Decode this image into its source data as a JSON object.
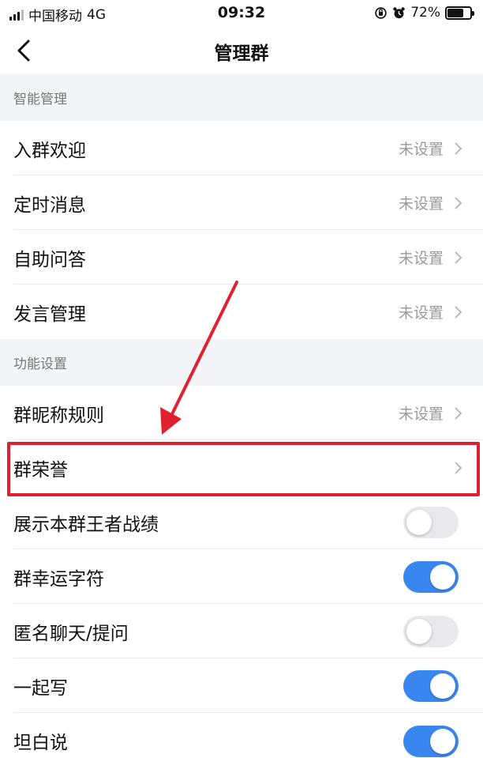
{
  "status_bar": {
    "carrier": "中国移动",
    "network": "4G",
    "time": "09:32",
    "battery": "72%",
    "battery_level": 0.72,
    "icons": [
      "signal-icon",
      "orientation-lock-icon",
      "alarm-icon",
      "battery-icon"
    ]
  },
  "nav": {
    "title": "管理群",
    "back_icon": "chevron-left-icon"
  },
  "sections": [
    {
      "header": "智能管理",
      "items": [
        {
          "label": "入群欢迎",
          "value": "未设置",
          "type": "link"
        },
        {
          "label": "定时消息",
          "value": "未设置",
          "type": "link"
        },
        {
          "label": "自助问答",
          "value": "未设置",
          "type": "link"
        },
        {
          "label": "发言管理",
          "value": "未设置",
          "type": "link"
        }
      ]
    },
    {
      "header": "功能设置",
      "items": [
        {
          "label": "群昵称规则",
          "value": "未设置",
          "type": "link"
        },
        {
          "label": "群荣誉",
          "value": "",
          "type": "link"
        },
        {
          "label": "展示本群王者战绩",
          "type": "toggle",
          "on": false
        },
        {
          "label": "群幸运字符",
          "type": "toggle",
          "on": true
        },
        {
          "label": "匿名聊天/提问",
          "type": "toggle",
          "on": false
        },
        {
          "label": "一起写",
          "type": "toggle",
          "on": true
        },
        {
          "label": "坦白说",
          "type": "toggle",
          "on": true
        }
      ]
    }
  ],
  "colors": {
    "toggle_on": "#3a86f1",
    "toggle_off": "#e9e9ec",
    "annotation_red": "#e0202f",
    "section_bg": "#f4f5f8"
  }
}
